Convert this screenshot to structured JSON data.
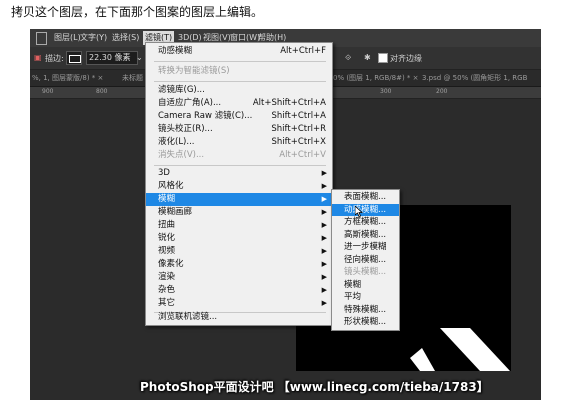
{
  "instruction": "拷贝这个图层，在下面那个图案的图层上编辑。",
  "menubar": {
    "items": [
      "图层(L)",
      "文字(Y)",
      "选择(S)",
      "滤镜(T)",
      "3D(D)",
      "视图(V)",
      "窗口(W)",
      "帮助(H)"
    ]
  },
  "options_bar": {
    "stroke_label": "描边:",
    "stroke_size": "22.30 像素",
    "align_edges_label": "对齐边缘"
  },
  "tabs": [
    "%, 1, 图层蒙版/8) * ×",
    "未标题",
    "0% (图层 1, RGB/8#) * ×",
    "3.psd @ 50% (圆角矩形 1, RGB"
  ],
  "ruler_ticks": [
    "900",
    "800",
    "700",
    "600",
    "500",
    "400",
    "300",
    "200"
  ],
  "filter_menu": {
    "top": [
      {
        "label": "动感模糊",
        "shortcut": "Alt+Ctrl+F",
        "disabled": false
      }
    ],
    "convert": [
      {
        "label": "转换为智能滤镜(S)",
        "disabled": true
      }
    ],
    "gallery": [
      {
        "label": "滤镜库(G)...",
        "shortcut": "",
        "disabled": false
      },
      {
        "label": "自适应广角(A)...",
        "shortcut": "Alt+Shift+Ctrl+A",
        "disabled": false
      },
      {
        "label": "Camera Raw 滤镜(C)...",
        "shortcut": "Shift+Ctrl+A",
        "disabled": false
      },
      {
        "label": "镜头校正(R)...",
        "shortcut": "Shift+Ctrl+R",
        "disabled": false
      },
      {
        "label": "液化(L)...",
        "shortcut": "Shift+Ctrl+X",
        "disabled": false
      },
      {
        "label": "消失点(V)...",
        "shortcut": "Alt+Ctrl+V",
        "disabled": true
      }
    ],
    "categories": [
      {
        "label": "3D"
      },
      {
        "label": "风格化"
      },
      {
        "label": "模糊",
        "highlighted": true
      },
      {
        "label": "模糊画廊"
      },
      {
        "label": "扭曲"
      },
      {
        "label": "锐化"
      },
      {
        "label": "视频"
      },
      {
        "label": "像素化"
      },
      {
        "label": "渲染"
      },
      {
        "label": "杂色"
      },
      {
        "label": "其它"
      }
    ],
    "browse": "浏览联机滤镜..."
  },
  "blur_submenu": [
    {
      "label": "表面模糊...",
      "disabled": false
    },
    {
      "label": "动感模糊...",
      "highlighted": true
    },
    {
      "label": "方框模糊...",
      "disabled": false
    },
    {
      "label": "高斯模糊...",
      "disabled": false
    },
    {
      "label": "进一步模糊",
      "disabled": false
    },
    {
      "label": "径向模糊...",
      "disabled": false
    },
    {
      "label": "镜头模糊...",
      "disabled": true
    },
    {
      "label": "模糊",
      "disabled": false
    },
    {
      "label": "平均",
      "disabled": false
    },
    {
      "label": "特殊模糊...",
      "disabled": false
    },
    {
      "label": "形状模糊...",
      "disabled": false
    }
  ],
  "watermark": "PhotoShop平面设计吧 【www.linecg.com/tieba/1783】",
  "colors": {
    "highlight": "#1e88e5",
    "menu_bg": "#f0f0f0",
    "ps_bg": "#2b2b2b"
  }
}
